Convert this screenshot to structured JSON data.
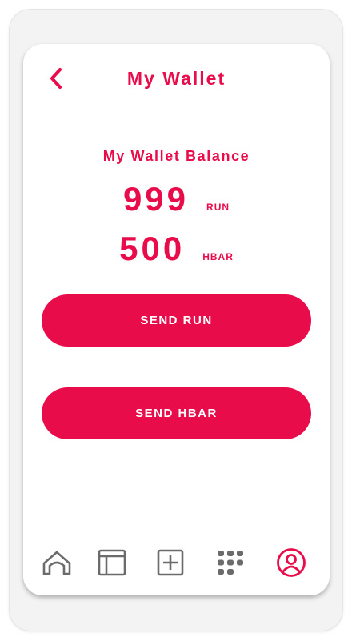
{
  "header": {
    "back_icon": "chevron-left-icon",
    "title": "My Wallet"
  },
  "wallet": {
    "balance_label": "My Wallet Balance",
    "balances": [
      {
        "amount": "999",
        "unit": "RUN"
      },
      {
        "amount": "500",
        "unit": "HBAR"
      }
    ]
  },
  "actions": {
    "send_run_label": "SEND RUN",
    "send_hbar_label": "SEND HBAR"
  },
  "bottom_nav": {
    "items": [
      {
        "icon": "home-icon",
        "active": false
      },
      {
        "icon": "layout-icon",
        "active": false
      },
      {
        "icon": "add-square-icon",
        "active": false
      },
      {
        "icon": "apps-grid-icon",
        "active": false
      },
      {
        "icon": "profile-icon",
        "active": true
      }
    ]
  },
  "colors": {
    "accent": "#e90c4a",
    "inactive_icon": "#6b6b6b",
    "background": "#ffffff",
    "device_frame": "#f3f3f3"
  }
}
